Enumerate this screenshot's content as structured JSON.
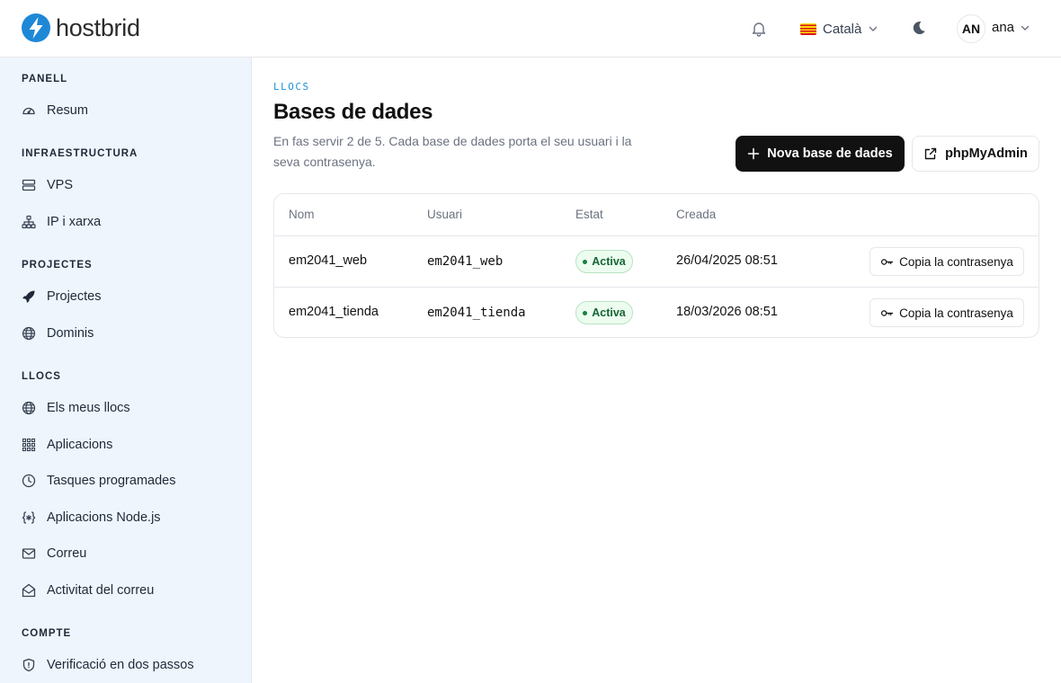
{
  "header": {
    "brand": "hostbrid",
    "language": "Català",
    "user_initials": "AN",
    "user_name": "ana"
  },
  "sidebar": {
    "sections": [
      {
        "title": "PANELL",
        "items": [
          {
            "label": "Resum",
            "icon": "gauge-icon"
          }
        ]
      },
      {
        "title": "INFRAESTRUCTURA",
        "items": [
          {
            "label": "VPS",
            "icon": "server-icon"
          },
          {
            "label": "IP i xarxa",
            "icon": "network-icon"
          }
        ]
      },
      {
        "title": "PROJECTES",
        "items": [
          {
            "label": "Projectes",
            "icon": "rocket-icon"
          },
          {
            "label": "Dominis",
            "icon": "globe-icon"
          }
        ]
      },
      {
        "title": "LLOCS",
        "items": [
          {
            "label": "Els meus llocs",
            "icon": "globe-icon"
          },
          {
            "label": "Aplicacions",
            "icon": "grid-icon"
          },
          {
            "label": "Tasques programades",
            "icon": "clock-icon"
          },
          {
            "label": "Aplicacions Node.js",
            "icon": "code-braces-icon"
          },
          {
            "label": "Correu",
            "icon": "mail-icon"
          },
          {
            "label": "Activitat del correu",
            "icon": "mail-open-icon"
          }
        ]
      },
      {
        "title": "COMPTE",
        "items": [
          {
            "label": "Verificació en dos passos",
            "icon": "shield-icon"
          }
        ]
      }
    ]
  },
  "main": {
    "eyebrow": "LLOCS",
    "title": "Bases de dades",
    "description": "En fas servir 2 de 5. Cada base de dades porta el seu usuari i la seva contrasenya.",
    "new_button": "Nova base de dades",
    "phpmyadmin_button": "phpMyAdmin",
    "table": {
      "columns": [
        "Nom",
        "Usuari",
        "Estat",
        "Creada"
      ],
      "rows": [
        {
          "name": "em2041_web",
          "user": "em2041_web",
          "status": "Activa",
          "created": "26/04/2025 08:51",
          "action": "Copia la contrasenya"
        },
        {
          "name": "em2041_tienda",
          "user": "em2041_tienda",
          "status": "Activa",
          "created": "18/03/2026 08:51",
          "action": "Copia la contrasenya"
        }
      ]
    }
  },
  "colors": {
    "accent": "#1a8fd6",
    "sidebar_bg": "#eef5fd",
    "primary_button": "#111111",
    "status_active": "#15803d"
  }
}
